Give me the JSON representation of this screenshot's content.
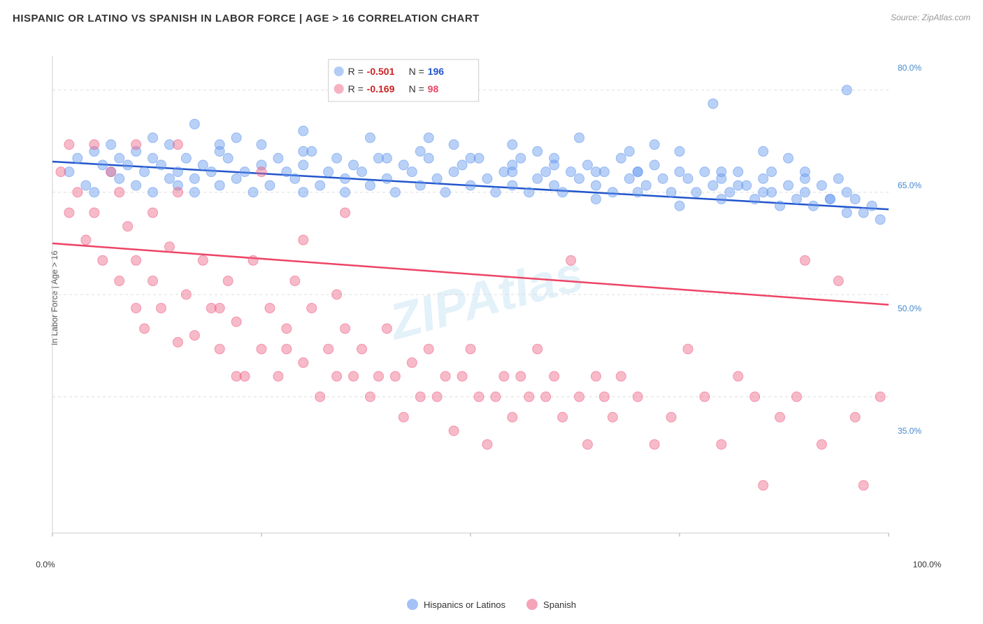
{
  "title": "HISPANIC OR LATINO VS SPANISH IN LABOR FORCE | AGE > 16 CORRELATION CHART",
  "source": "Source: ZipAtlas.com",
  "watermark": "ZIPAtlas",
  "y_axis_label": "In Labor Force | Age > 16",
  "legend": {
    "items": [
      {
        "id": "hispanics",
        "label": "Hispanics or Latinos",
        "color": "#6699ee"
      },
      {
        "id": "spanish",
        "label": "Spanish",
        "color": "#ee6688"
      }
    ]
  },
  "stats": {
    "blue": {
      "r": "-0.501",
      "n": "196",
      "color": "#4477dd"
    },
    "pink": {
      "r": "-0.169",
      "n": "98",
      "color": "#ee6688"
    }
  },
  "x_ticks": [
    "0.0%",
    "100.0%"
  ],
  "y_ticks": [
    "35.0%",
    "50.0%",
    "65.0%",
    "80.0%"
  ],
  "blue_dots": [
    [
      0.02,
      0.68
    ],
    [
      0.03,
      0.7
    ],
    [
      0.04,
      0.66
    ],
    [
      0.05,
      0.71
    ],
    [
      0.05,
      0.65
    ],
    [
      0.06,
      0.69
    ],
    [
      0.07,
      0.68
    ],
    [
      0.07,
      0.72
    ],
    [
      0.08,
      0.67
    ],
    [
      0.08,
      0.7
    ],
    [
      0.09,
      0.69
    ],
    [
      0.1,
      0.66
    ],
    [
      0.1,
      0.71
    ],
    [
      0.11,
      0.68
    ],
    [
      0.12,
      0.65
    ],
    [
      0.12,
      0.7
    ],
    [
      0.13,
      0.69
    ],
    [
      0.14,
      0.67
    ],
    [
      0.14,
      0.72
    ],
    [
      0.15,
      0.68
    ],
    [
      0.15,
      0.66
    ],
    [
      0.16,
      0.7
    ],
    [
      0.17,
      0.67
    ],
    [
      0.17,
      0.65
    ],
    [
      0.18,
      0.69
    ],
    [
      0.19,
      0.68
    ],
    [
      0.2,
      0.71
    ],
    [
      0.2,
      0.66
    ],
    [
      0.21,
      0.7
    ],
    [
      0.22,
      0.67
    ],
    [
      0.23,
      0.68
    ],
    [
      0.24,
      0.65
    ],
    [
      0.25,
      0.69
    ],
    [
      0.25,
      0.72
    ],
    [
      0.26,
      0.66
    ],
    [
      0.27,
      0.7
    ],
    [
      0.28,
      0.68
    ],
    [
      0.29,
      0.67
    ],
    [
      0.3,
      0.65
    ],
    [
      0.3,
      0.69
    ],
    [
      0.31,
      0.71
    ],
    [
      0.32,
      0.66
    ],
    [
      0.33,
      0.68
    ],
    [
      0.34,
      0.7
    ],
    [
      0.35,
      0.67
    ],
    [
      0.35,
      0.65
    ],
    [
      0.36,
      0.69
    ],
    [
      0.37,
      0.68
    ],
    [
      0.38,
      0.66
    ],
    [
      0.39,
      0.7
    ],
    [
      0.4,
      0.67
    ],
    [
      0.41,
      0.65
    ],
    [
      0.42,
      0.69
    ],
    [
      0.43,
      0.68
    ],
    [
      0.44,
      0.71
    ],
    [
      0.44,
      0.66
    ],
    [
      0.45,
      0.7
    ],
    [
      0.46,
      0.67
    ],
    [
      0.47,
      0.65
    ],
    [
      0.48,
      0.68
    ],
    [
      0.49,
      0.69
    ],
    [
      0.5,
      0.66
    ],
    [
      0.51,
      0.7
    ],
    [
      0.52,
      0.67
    ],
    [
      0.53,
      0.65
    ],
    [
      0.54,
      0.68
    ],
    [
      0.55,
      0.69
    ],
    [
      0.55,
      0.66
    ],
    [
      0.56,
      0.7
    ],
    [
      0.57,
      0.65
    ],
    [
      0.58,
      0.67
    ],
    [
      0.59,
      0.68
    ],
    [
      0.6,
      0.66
    ],
    [
      0.6,
      0.7
    ],
    [
      0.61,
      0.65
    ],
    [
      0.62,
      0.68
    ],
    [
      0.63,
      0.67
    ],
    [
      0.64,
      0.69
    ],
    [
      0.65,
      0.66
    ],
    [
      0.65,
      0.64
    ],
    [
      0.66,
      0.68
    ],
    [
      0.67,
      0.65
    ],
    [
      0.68,
      0.7
    ],
    [
      0.69,
      0.67
    ],
    [
      0.7,
      0.65
    ],
    [
      0.7,
      0.68
    ],
    [
      0.71,
      0.66
    ],
    [
      0.72,
      0.69
    ],
    [
      0.73,
      0.67
    ],
    [
      0.74,
      0.65
    ],
    [
      0.75,
      0.68
    ],
    [
      0.75,
      0.63
    ],
    [
      0.76,
      0.67
    ],
    [
      0.77,
      0.65
    ],
    [
      0.78,
      0.68
    ],
    [
      0.79,
      0.66
    ],
    [
      0.8,
      0.64
    ],
    [
      0.8,
      0.67
    ],
    [
      0.81,
      0.65
    ],
    [
      0.82,
      0.68
    ],
    [
      0.83,
      0.66
    ],
    [
      0.84,
      0.64
    ],
    [
      0.85,
      0.67
    ],
    [
      0.85,
      0.65
    ],
    [
      0.86,
      0.68
    ],
    [
      0.87,
      0.63
    ],
    [
      0.88,
      0.66
    ],
    [
      0.89,
      0.64
    ],
    [
      0.9,
      0.67
    ],
    [
      0.9,
      0.65
    ],
    [
      0.91,
      0.63
    ],
    [
      0.92,
      0.66
    ],
    [
      0.93,
      0.64
    ],
    [
      0.94,
      0.67
    ],
    [
      0.95,
      0.65
    ],
    [
      0.95,
      0.62
    ],
    [
      0.96,
      0.64
    ],
    [
      0.97,
      0.62
    ],
    [
      0.98,
      0.63
    ],
    [
      0.99,
      0.61
    ],
    [
      0.17,
      0.75
    ],
    [
      0.22,
      0.73
    ],
    [
      0.3,
      0.74
    ],
    [
      0.38,
      0.73
    ],
    [
      0.45,
      0.73
    ],
    [
      0.55,
      0.72
    ],
    [
      0.63,
      0.73
    ],
    [
      0.72,
      0.72
    ],
    [
      0.79,
      0.78
    ],
    [
      0.85,
      0.71
    ],
    [
      0.95,
      0.8
    ],
    [
      0.48,
      0.72
    ],
    [
      0.58,
      0.71
    ],
    [
      0.69,
      0.71
    ],
    [
      0.75,
      0.71
    ],
    [
      0.88,
      0.7
    ],
    [
      0.2,
      0.72
    ],
    [
      0.3,
      0.71
    ],
    [
      0.4,
      0.7
    ],
    [
      0.12,
      0.73
    ],
    [
      0.5,
      0.7
    ],
    [
      0.6,
      0.69
    ],
    [
      0.7,
      0.68
    ],
    [
      0.55,
      0.68
    ],
    [
      0.65,
      0.68
    ],
    [
      0.8,
      0.68
    ],
    [
      0.9,
      0.68
    ],
    [
      0.82,
      0.66
    ],
    [
      0.86,
      0.65
    ],
    [
      0.93,
      0.64
    ]
  ],
  "pink_dots": [
    [
      0.01,
      0.68
    ],
    [
      0.02,
      0.72
    ],
    [
      0.03,
      0.65
    ],
    [
      0.04,
      0.58
    ],
    [
      0.05,
      0.62
    ],
    [
      0.06,
      0.55
    ],
    [
      0.07,
      0.68
    ],
    [
      0.08,
      0.52
    ],
    [
      0.09,
      0.6
    ],
    [
      0.1,
      0.48
    ],
    [
      0.1,
      0.55
    ],
    [
      0.11,
      0.45
    ],
    [
      0.12,
      0.52
    ],
    [
      0.13,
      0.48
    ],
    [
      0.14,
      0.57
    ],
    [
      0.15,
      0.43
    ],
    [
      0.15,
      0.65
    ],
    [
      0.16,
      0.5
    ],
    [
      0.17,
      0.44
    ],
    [
      0.18,
      0.55
    ],
    [
      0.19,
      0.48
    ],
    [
      0.2,
      0.42
    ],
    [
      0.21,
      0.52
    ],
    [
      0.22,
      0.46
    ],
    [
      0.23,
      0.38
    ],
    [
      0.24,
      0.55
    ],
    [
      0.25,
      0.42
    ],
    [
      0.26,
      0.48
    ],
    [
      0.27,
      0.38
    ],
    [
      0.28,
      0.45
    ],
    [
      0.29,
      0.52
    ],
    [
      0.3,
      0.4
    ],
    [
      0.31,
      0.48
    ],
    [
      0.32,
      0.35
    ],
    [
      0.33,
      0.42
    ],
    [
      0.34,
      0.38
    ],
    [
      0.35,
      0.45
    ],
    [
      0.36,
      0.38
    ],
    [
      0.37,
      0.42
    ],
    [
      0.38,
      0.35
    ],
    [
      0.39,
      0.38
    ],
    [
      0.4,
      0.45
    ],
    [
      0.41,
      0.38
    ],
    [
      0.42,
      0.32
    ],
    [
      0.43,
      0.4
    ],
    [
      0.44,
      0.35
    ],
    [
      0.45,
      0.42
    ],
    [
      0.46,
      0.35
    ],
    [
      0.47,
      0.38
    ],
    [
      0.48,
      0.3
    ],
    [
      0.49,
      0.38
    ],
    [
      0.5,
      0.42
    ],
    [
      0.51,
      0.35
    ],
    [
      0.52,
      0.28
    ],
    [
      0.53,
      0.35
    ],
    [
      0.54,
      0.38
    ],
    [
      0.55,
      0.32
    ],
    [
      0.56,
      0.38
    ],
    [
      0.57,
      0.35
    ],
    [
      0.58,
      0.42
    ],
    [
      0.59,
      0.35
    ],
    [
      0.6,
      0.38
    ],
    [
      0.61,
      0.32
    ],
    [
      0.62,
      0.55
    ],
    [
      0.63,
      0.35
    ],
    [
      0.64,
      0.28
    ],
    [
      0.65,
      0.38
    ],
    [
      0.66,
      0.35
    ],
    [
      0.67,
      0.32
    ],
    [
      0.68,
      0.38
    ],
    [
      0.7,
      0.35
    ],
    [
      0.72,
      0.28
    ],
    [
      0.74,
      0.32
    ],
    [
      0.76,
      0.42
    ],
    [
      0.78,
      0.35
    ],
    [
      0.8,
      0.28
    ],
    [
      0.82,
      0.38
    ],
    [
      0.84,
      0.35
    ],
    [
      0.85,
      0.22
    ],
    [
      0.87,
      0.32
    ],
    [
      0.89,
      0.35
    ],
    [
      0.9,
      0.55
    ],
    [
      0.92,
      0.28
    ],
    [
      0.94,
      0.52
    ],
    [
      0.96,
      0.32
    ],
    [
      0.97,
      0.22
    ],
    [
      0.99,
      0.35
    ],
    [
      0.15,
      0.72
    ],
    [
      0.12,
      0.62
    ],
    [
      0.08,
      0.65
    ],
    [
      0.05,
      0.72
    ],
    [
      0.02,
      0.62
    ],
    [
      0.25,
      0.68
    ],
    [
      0.3,
      0.58
    ],
    [
      0.35,
      0.62
    ],
    [
      0.2,
      0.48
    ],
    [
      0.1,
      0.72
    ],
    [
      0.22,
      0.38
    ],
    [
      0.28,
      0.42
    ],
    [
      0.34,
      0.5
    ]
  ],
  "blue_trend": {
    "x1": 0,
    "y1": 0.695,
    "x2": 1,
    "y2": 0.625
  },
  "pink_trend": {
    "x1": 0,
    "y1": 0.575,
    "x2": 1,
    "y2": 0.485
  }
}
